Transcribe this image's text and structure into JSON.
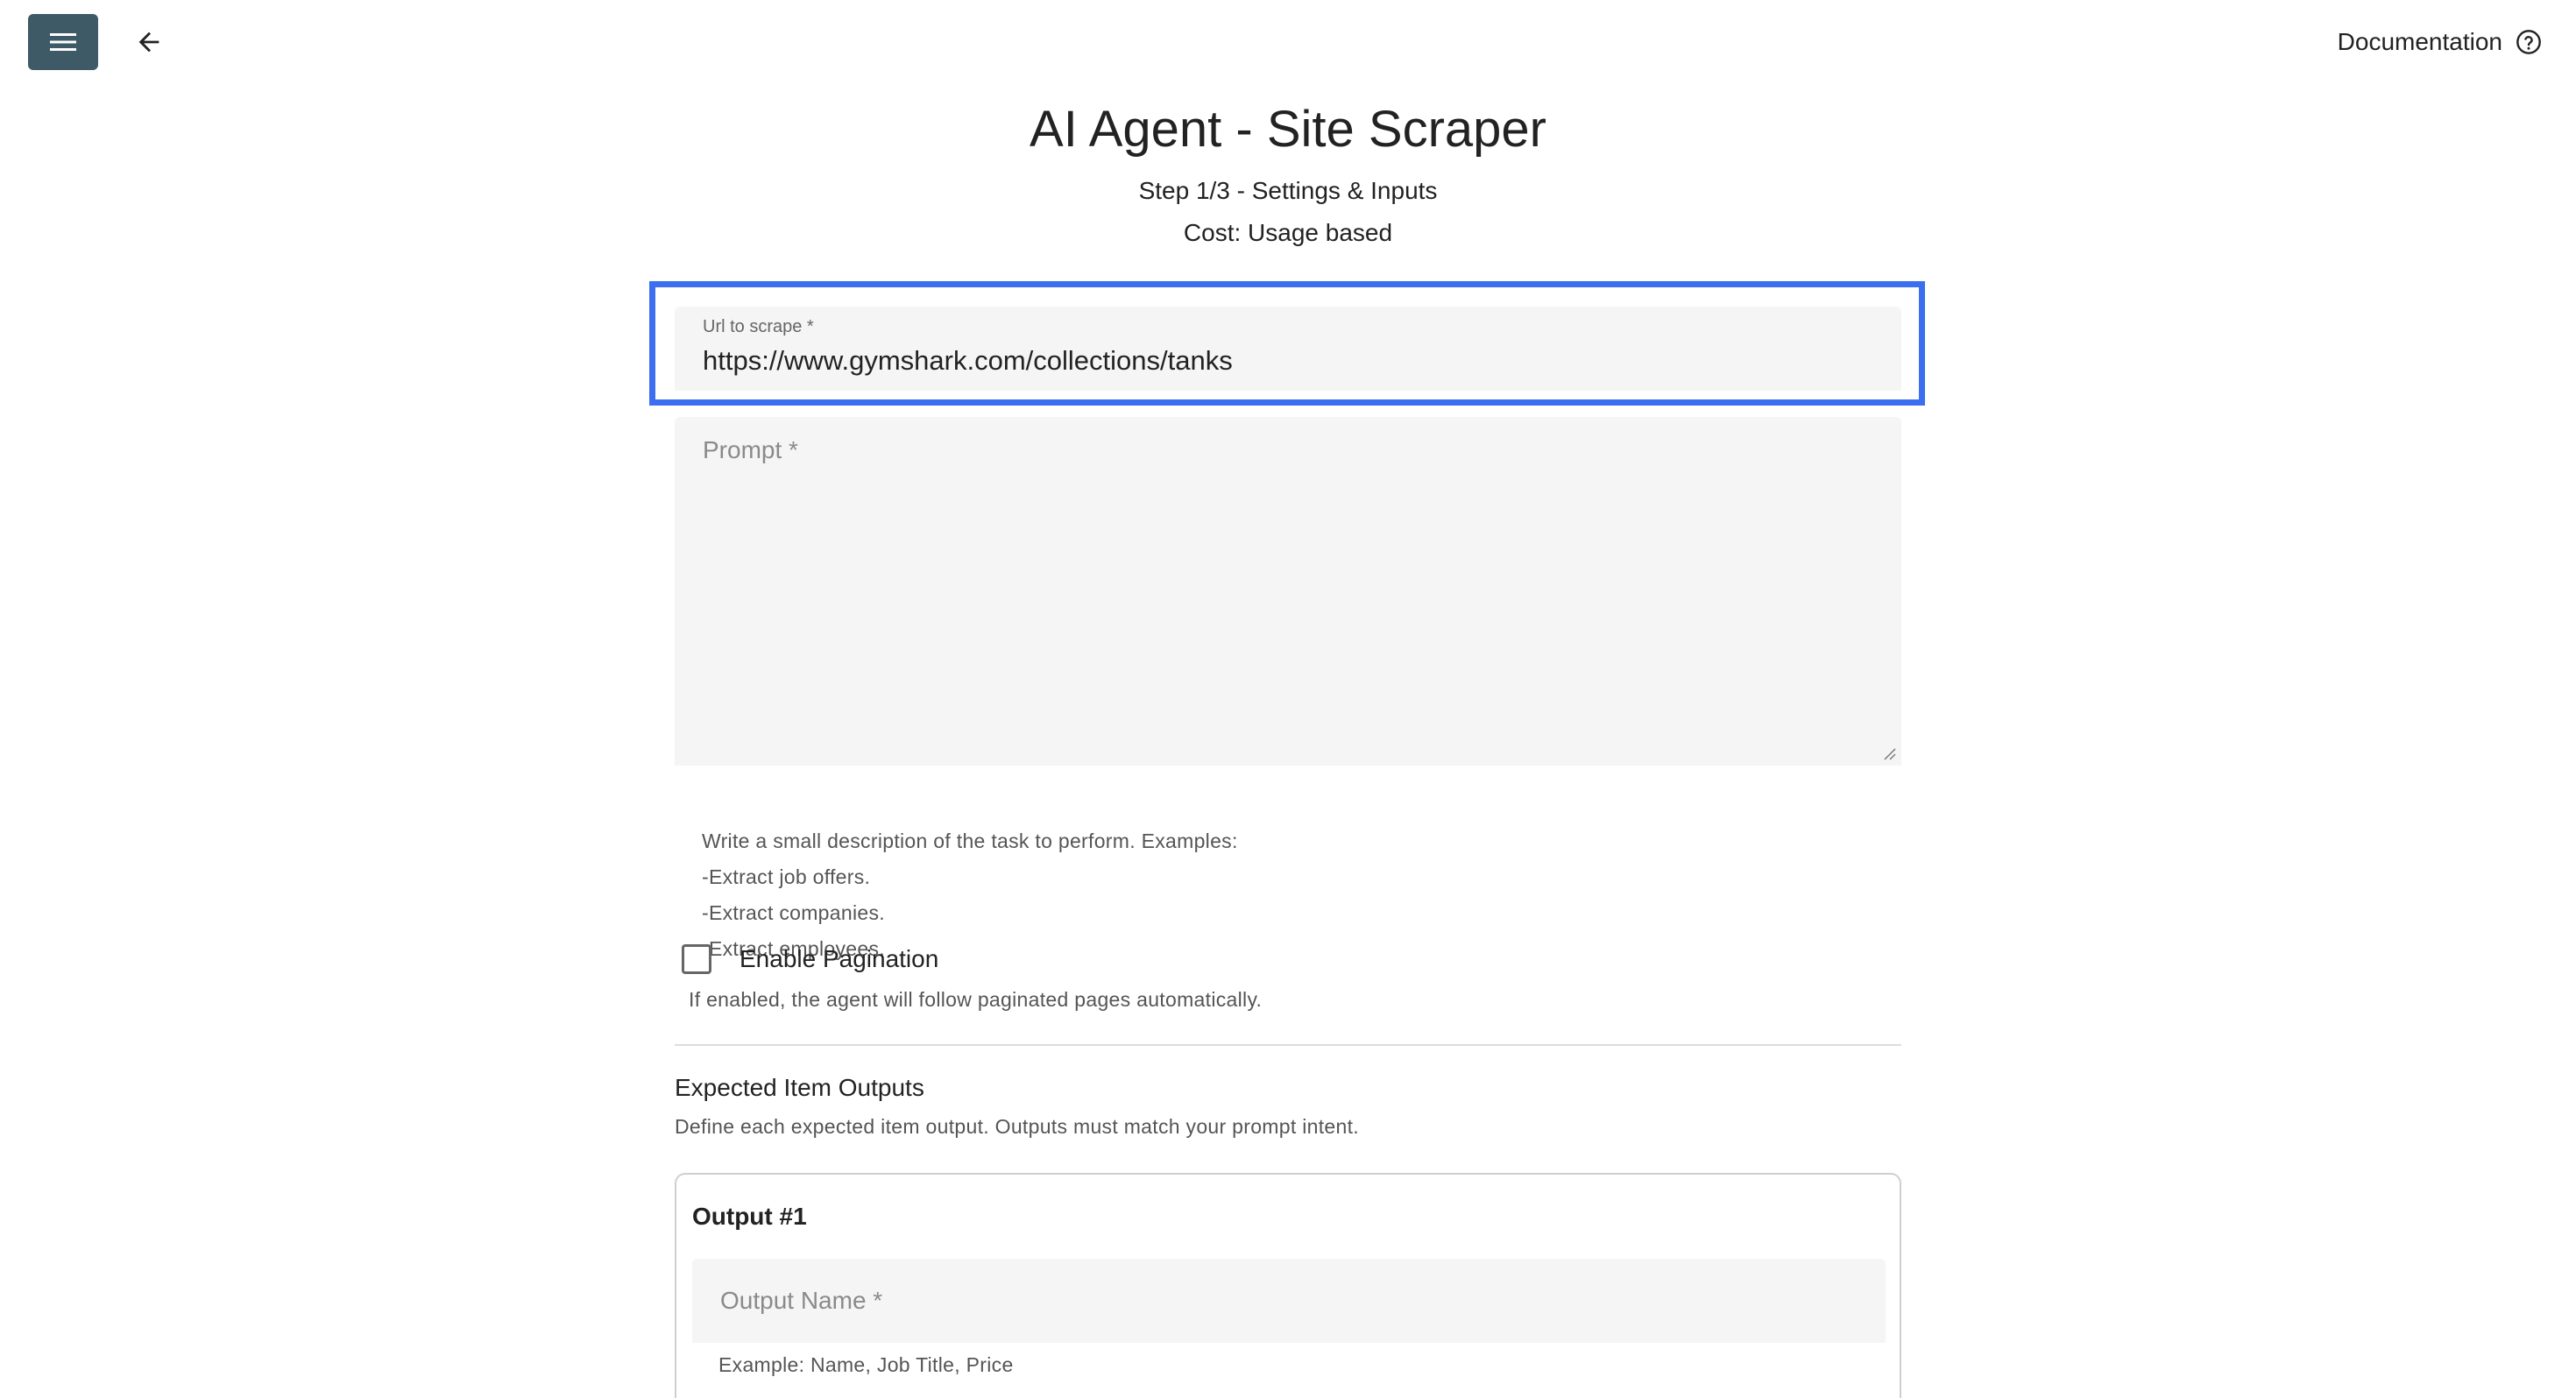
{
  "topbar": {
    "menu_icon": "menu-icon",
    "back_icon": "arrow-left-icon",
    "documentation_label": "Documentation",
    "help_icon": "help-circle-icon"
  },
  "header": {
    "title": "AI Agent - Site Scraper",
    "step": "Step 1/3 - Settings & Inputs",
    "cost": "Cost: Usage based"
  },
  "form": {
    "url": {
      "label": "Url to scrape *",
      "value": "https://www.gymshark.com/collections/tanks"
    },
    "prompt": {
      "placeholder": "Prompt *",
      "value": "",
      "hints": [
        "Write a small description of the task to perform. Examples:",
        "-Extract job offers.",
        "-Extract companies.",
        "-Extract employees."
      ]
    },
    "pagination": {
      "label": "Enable Pagination",
      "checked": false,
      "help": "If enabled, the agent will follow paginated pages automatically."
    },
    "outputs_section": {
      "title": "Expected Item Outputs",
      "description": "Define each expected item output. Outputs must match your prompt intent.",
      "items": [
        {
          "title": "Output #1",
          "name_placeholder": "Output Name *",
          "name_value": "",
          "hint": "Example: Name, Job Title, Price"
        }
      ]
    }
  },
  "colors": {
    "menu_button_bg": "#3d5a66",
    "highlight_border": "#3b6ff0",
    "field_bg": "#f4f5f4"
  }
}
